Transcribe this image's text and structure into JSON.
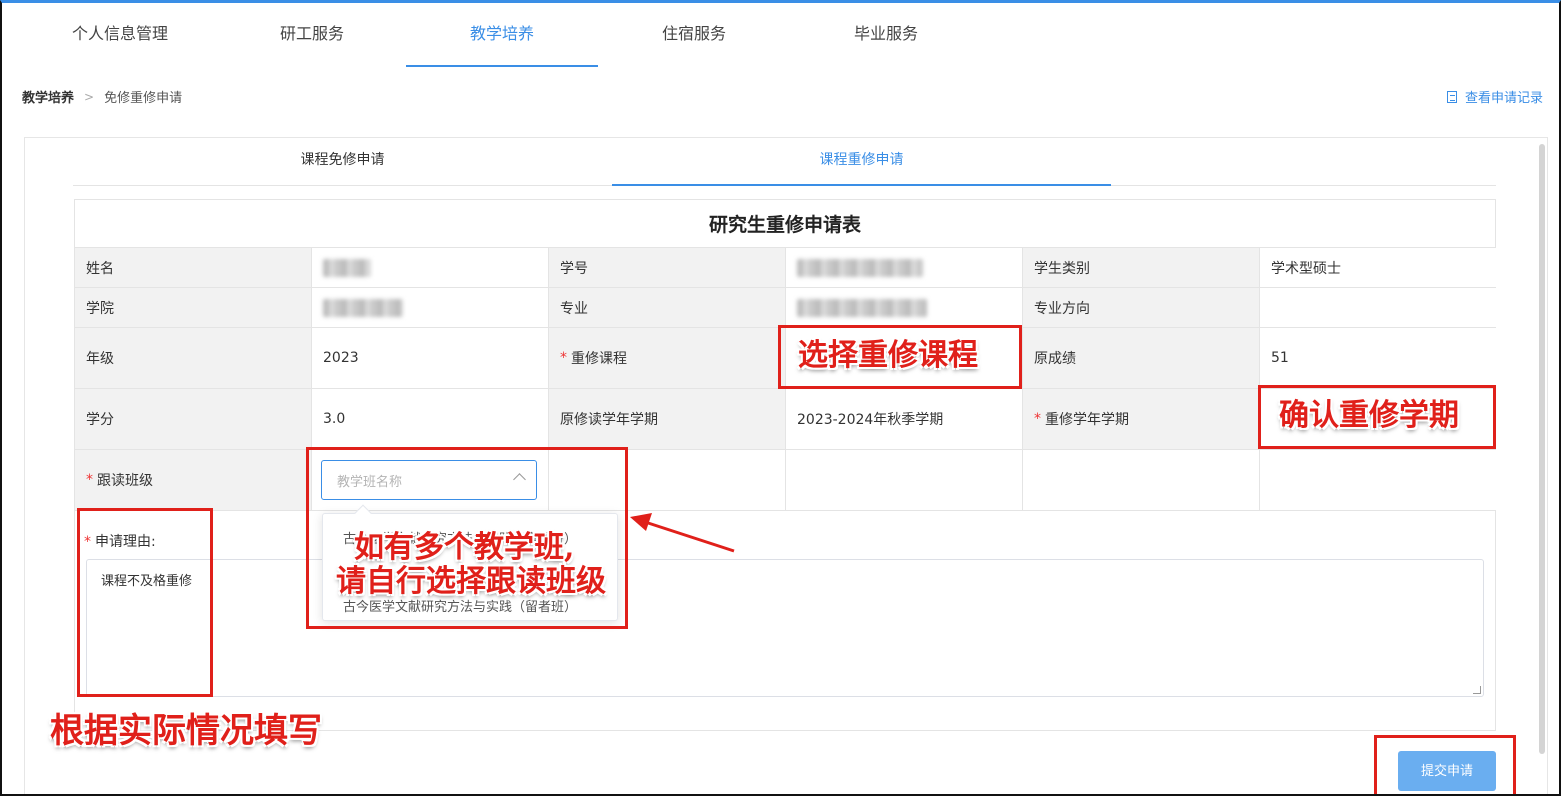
{
  "nav": {
    "tabs": [
      "个人信息管理",
      "研工服务",
      "教学培养",
      "住宿服务",
      "毕业服务"
    ],
    "active_index": 2
  },
  "breadcrumb": {
    "root": "教学培养",
    "current": "免修重修申请"
  },
  "history_link": "查看申请记录",
  "subtabs": {
    "left": "课程免修申请",
    "right": "课程重修申请"
  },
  "form": {
    "title": "研究生重修申请表",
    "labels": {
      "name": "姓名",
      "student_id": "学号",
      "student_type": "学生类别",
      "college": "学院",
      "major": "专业",
      "major_direction": "专业方向",
      "grade": "年级",
      "retake_course": "重修课程",
      "original_score": "原成绩",
      "credits": "学分",
      "original_term": "原修读学年学期",
      "retake_term": "重修学年学期",
      "follow_class": "跟读班级",
      "reason": "申请理由:"
    },
    "values": {
      "student_type": "学术型硕士",
      "grade": "2023",
      "original_score": "51",
      "credits": "3.0",
      "original_term": "2023-2024年秋季学期"
    },
    "required_mark": "*",
    "class_select": {
      "placeholder": "教学班名称"
    },
    "dropdown_items": [
      "古今医学文献研究方法与实践（寒暑班）",
      "古今医学文献研究方法与实践（留者班）"
    ],
    "reason_text": "课程不及格重修"
  },
  "submit_label": "提交申请",
  "annotations": {
    "select_course": "选择重修课程",
    "confirm_term": "确认重修学期",
    "multi_class_line1": "如有多个教学班,",
    "multi_class_line2": "请自行选择跟读班级",
    "fill_actual": "根据实际情况填写"
  }
}
